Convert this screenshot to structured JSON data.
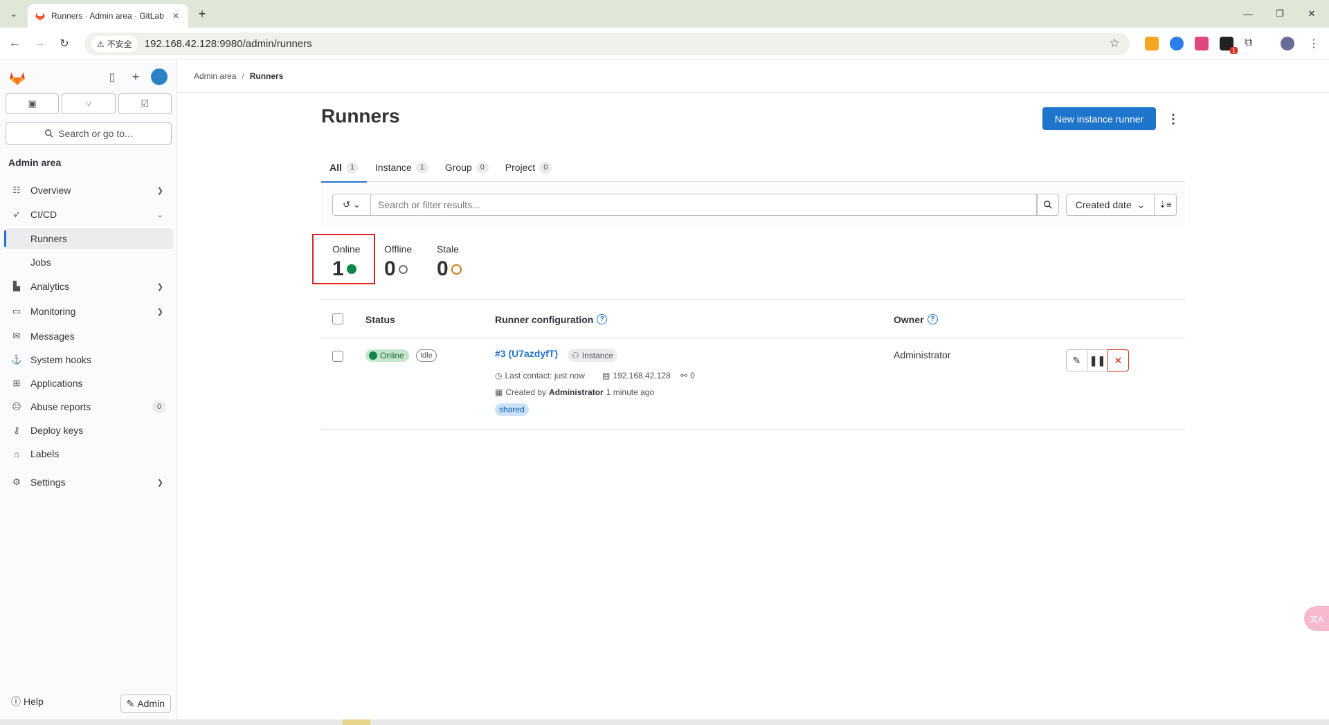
{
  "browser": {
    "tab_title": "Runners · Admin area · GitLab",
    "insecure_label": "不安全",
    "url": "192.168.42.128:9980/admin/runners",
    "extension_badge": "1"
  },
  "sidebar": {
    "search_placeholder": "Search or go to...",
    "section_title": "Admin area",
    "items": [
      {
        "label": "Overview",
        "icon": "overview-icon"
      },
      {
        "label": "CI/CD",
        "icon": "rocket-icon"
      },
      {
        "label": "Runners"
      },
      {
        "label": "Jobs"
      },
      {
        "label": "Analytics",
        "icon": "chart-icon"
      },
      {
        "label": "Monitoring",
        "icon": "monitor-icon"
      },
      {
        "label": "Messages",
        "icon": "messages-icon"
      },
      {
        "label": "System hooks",
        "icon": "hook-icon"
      },
      {
        "label": "Applications",
        "icon": "apps-icon"
      },
      {
        "label": "Abuse reports",
        "icon": "abuse-icon",
        "badge": "0"
      },
      {
        "label": "Deploy keys",
        "icon": "key-icon"
      },
      {
        "label": "Labels",
        "icon": "label-icon"
      },
      {
        "label": "Settings",
        "icon": "gear-icon"
      }
    ],
    "help_label": "Help",
    "admin_label": "Admin"
  },
  "breadcrumb": {
    "parent": "Admin area",
    "current": "Runners"
  },
  "page": {
    "title": "Runners",
    "new_runner_label": "New instance runner"
  },
  "tabs": [
    {
      "label": "All",
      "count": "1"
    },
    {
      "label": "Instance",
      "count": "1"
    },
    {
      "label": "Group",
      "count": "0"
    },
    {
      "label": "Project",
      "count": "0"
    }
  ],
  "filter": {
    "placeholder": "Search or filter results...",
    "sort_label": "Created date"
  },
  "stats": [
    {
      "label": "Online",
      "value": "1"
    },
    {
      "label": "Offline",
      "value": "0"
    },
    {
      "label": "Stale",
      "value": "0"
    }
  ],
  "table": {
    "headers": {
      "status": "Status",
      "config": "Runner configuration",
      "owner": "Owner"
    },
    "rows": [
      {
        "status": "Online",
        "state": "Idle",
        "name": "#3 (U7azdyfT)",
        "type": "Instance",
        "last_contact": "Last contact: just now",
        "ip": "192.168.42.128",
        "jobs": "0",
        "created_prefix": "Created by",
        "created_by": "Administrator",
        "created_ago": "1 minute ago",
        "tag": "shared",
        "owner": "Administrator"
      }
    ]
  },
  "colors": {
    "primary": "#1f75cb",
    "online": "#108548",
    "danger": "#dd2b0e",
    "highlight": "#e02424"
  }
}
